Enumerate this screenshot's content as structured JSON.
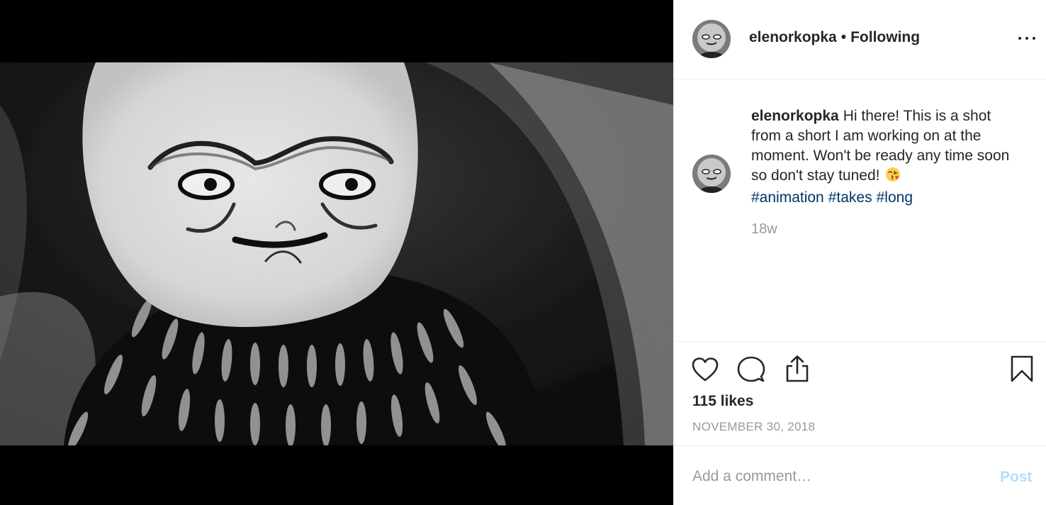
{
  "post": {
    "username": "elenorkopka",
    "separator": "•",
    "follow_status": "Following",
    "caption_text": "Hi there! This is a shot from a short I am working on at the moment. Won't be ready any time soon so don't stay tuned!",
    "hashtags": [
      "#animation",
      "#takes",
      "#long"
    ],
    "time_ago": "18w",
    "likes": "115 likes",
    "date": "NOVEMBER 30, 2018"
  },
  "comment": {
    "placeholder": "Add a comment…",
    "post_label": "Post"
  },
  "icons": {
    "more": "more-options-icon",
    "like": "heart-icon",
    "comment": "comment-bubble-icon",
    "share": "share-upload-icon",
    "save": "bookmark-icon",
    "emoji": "kissing-face-emoji"
  },
  "colors": {
    "link": "#003569",
    "muted": "#999999",
    "post_button_disabled": "#b2dffc",
    "text": "#262626"
  }
}
